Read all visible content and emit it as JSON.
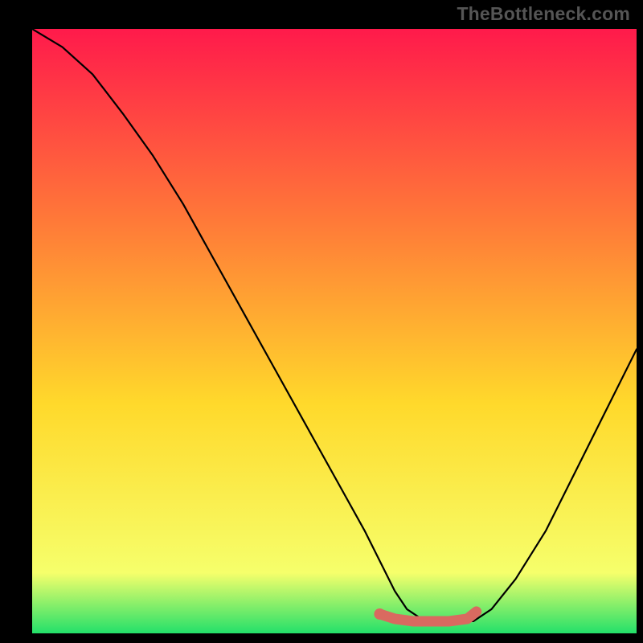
{
  "attribution": "TheBottleneck.com",
  "colors": {
    "frame": "#000000",
    "grad_top": "#ff1a4b",
    "grad_mid1": "#ff7a38",
    "grad_mid2": "#ffd92b",
    "grad_low": "#f6ff6b",
    "grad_bottom": "#23e06a",
    "curve": "#000000",
    "highlight": "#d96a60"
  },
  "chart_data": {
    "type": "line",
    "title": "",
    "xlabel": "",
    "ylabel": "",
    "xlim": [
      0,
      100
    ],
    "ylim": [
      0,
      100
    ],
    "series": [
      {
        "name": "bottleneck-curve",
        "x": [
          0,
          5,
          10,
          15,
          20,
          25,
          30,
          35,
          40,
          45,
          50,
          55,
          58,
          60,
          62,
          65,
          68,
          70,
          73,
          76,
          80,
          85,
          90,
          95,
          100
        ],
        "y": [
          100,
          97,
          92.5,
          86,
          79,
          71,
          62,
          53,
          44,
          35,
          26,
          17,
          11,
          7,
          4,
          2,
          2,
          2,
          2,
          4,
          9,
          17,
          27,
          37,
          47
        ]
      }
    ],
    "highlight_segment": {
      "name": "optimal-range",
      "x": [
        57.5,
        60,
        63,
        66,
        69,
        72,
        73.5
      ],
      "y": [
        3.2,
        2.4,
        2.0,
        2.0,
        2.0,
        2.4,
        3.6
      ]
    }
  }
}
